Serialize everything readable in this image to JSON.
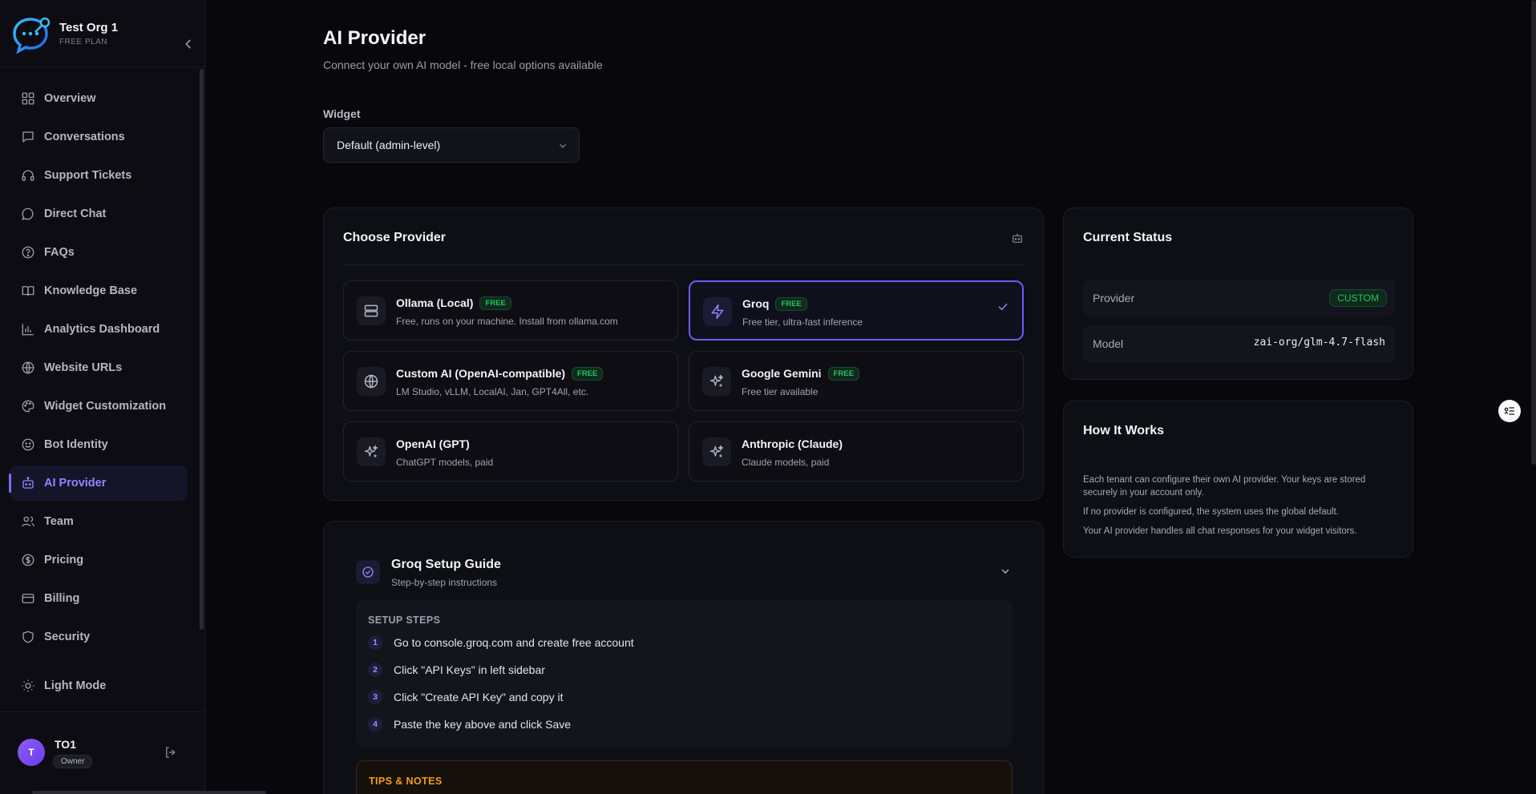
{
  "org": {
    "name": "Test Org 1",
    "plan": "FREE PLAN"
  },
  "nav": {
    "items": [
      {
        "label": "Overview",
        "icon": "grid-icon"
      },
      {
        "label": "Conversations",
        "icon": "message-square-icon"
      },
      {
        "label": "Support Tickets",
        "icon": "headphones-icon"
      },
      {
        "label": "Direct Chat",
        "icon": "message-circle-icon"
      },
      {
        "label": "FAQs",
        "icon": "help-circle-icon"
      },
      {
        "label": "Knowledge Base",
        "icon": "book-icon"
      },
      {
        "label": "Analytics Dashboard",
        "icon": "bar-chart-icon"
      },
      {
        "label": "Website URLs",
        "icon": "globe-icon"
      },
      {
        "label": "Widget Customization",
        "icon": "palette-icon"
      },
      {
        "label": "Bot Identity",
        "icon": "smile-icon"
      },
      {
        "label": "AI Provider",
        "icon": "bot-icon",
        "active": true
      },
      {
        "label": "Team",
        "icon": "users-icon"
      },
      {
        "label": "Pricing",
        "icon": "dollar-circle-icon"
      },
      {
        "label": "Billing",
        "icon": "credit-card-icon"
      },
      {
        "label": "Security",
        "icon": "shield-icon"
      }
    ],
    "light_mode": "Light Mode"
  },
  "user": {
    "initial": "T",
    "name": "TO1",
    "role": "Owner"
  },
  "page": {
    "title": "AI Provider",
    "subtitle": "Connect your own AI model - free local options available",
    "widget_label": "Widget",
    "widget_value": "Default (admin-level)"
  },
  "choose": {
    "title": "Choose Provider",
    "providers": [
      {
        "name": "Ollama (Local)",
        "badge": "FREE",
        "desc": "Free, runs on your machine. Install from ollama.com",
        "icon": "server-icon"
      },
      {
        "name": "Groq",
        "badge": "FREE",
        "desc": "Free tier, ultra-fast inference",
        "icon": "zap-icon",
        "selected": true
      },
      {
        "name": "Custom AI (OpenAI-compatible)",
        "badge": "FREE",
        "desc": "LM Studio, vLLM, LocalAI, Jan, GPT4All, etc.",
        "icon": "globe-icon"
      },
      {
        "name": "Google Gemini",
        "badge": "FREE",
        "desc": "Free tier available",
        "icon": "sparkles-icon"
      },
      {
        "name": "OpenAI (GPT)",
        "badge": "",
        "desc": "ChatGPT models, paid",
        "icon": "sparkles-icon"
      },
      {
        "name": "Anthropic (Claude)",
        "badge": "",
        "desc": "Claude models, paid",
        "icon": "sparkles-icon"
      }
    ]
  },
  "status": {
    "title": "Current Status",
    "provider_label": "Provider",
    "provider_value": "CUSTOM",
    "model_label": "Model",
    "model_value": "zai-org/glm-4.7-flash"
  },
  "how": {
    "title": "How It Works",
    "p1": "Each tenant can configure their own AI provider. Your keys are stored securely in your account only.",
    "p2": "If no provider is configured, the system uses the global default.",
    "p3": "Your AI provider handles all chat responses for your widget visitors."
  },
  "guide": {
    "title": "Groq Setup Guide",
    "subtitle": "Step-by-step instructions",
    "steps_title": "SETUP STEPS",
    "steps": [
      {
        "num": "1",
        "text": "Go to console.groq.com and create free account"
      },
      {
        "num": "2",
        "text": "Click \"API Keys\" in left sidebar"
      },
      {
        "num": "3",
        "text": "Click \"Create API Key\" and copy it"
      },
      {
        "num": "4",
        "text": "Paste the key above and click Save"
      }
    ],
    "tips_title": "TIPS & NOTES"
  },
  "colors": {
    "accent": "#7c6cff",
    "free_badge": "#22c55e",
    "tips": "#f59e0b",
    "background": "#08080c"
  }
}
